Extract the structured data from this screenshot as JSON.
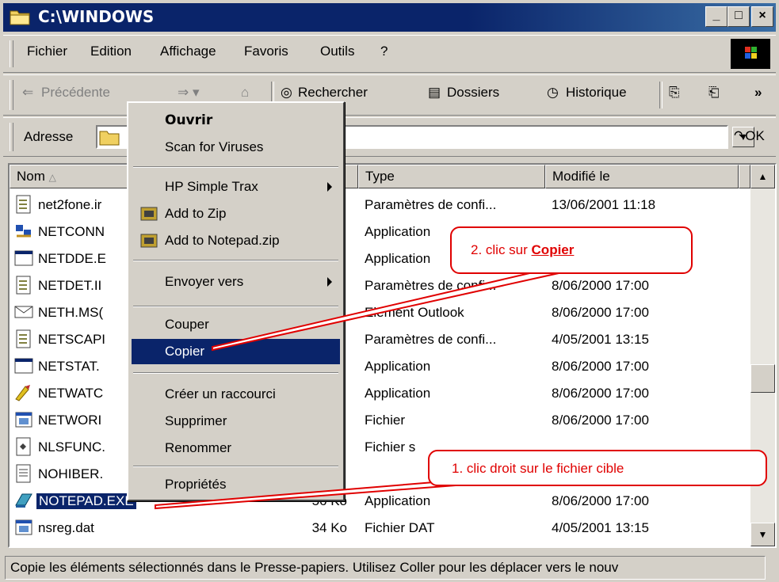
{
  "window": {
    "title": "C:\\WINDOWS",
    "min": "_",
    "max": "□",
    "close": "×"
  },
  "menubar": {
    "items": [
      "Fichier",
      "Edition",
      "Affichage",
      "Favoris",
      "Outils",
      "?"
    ]
  },
  "toolbar": {
    "back": "Précédente",
    "search": "Rechercher",
    "folders": "Dossiers",
    "history": "Historique",
    "more": "»"
  },
  "address": {
    "label": "Adresse",
    "go": "OK"
  },
  "columns": {
    "name": "Nom",
    "sort_indicator": "△",
    "type": "Type",
    "modified": "Modifié le"
  },
  "files": [
    {
      "name": "net2fone.ini",
      "size": "",
      "type": "Paramètres de confi...",
      "modified": "13/06/2001 11:18",
      "icon": "ini-file-icon"
    },
    {
      "name": "NETCONN.EXE",
      "size": "",
      "type": "Application",
      "modified": "",
      "icon": "network-exe-icon"
    },
    {
      "name": "NETDDE.EXE",
      "size": "",
      "type": "Application",
      "modified": "",
      "icon": "window-exe-icon"
    },
    {
      "name": "NETDET.INI",
      "size": "",
      "type": "Paramètres de confi...",
      "modified": "8/06/2000 17:00",
      "icon": "ini-file-icon"
    },
    {
      "name": "NETH.MSG",
      "size": "",
      "type": "Elément Outlook",
      "modified": "8/06/2000 17:00",
      "icon": "mail-icon"
    },
    {
      "name": "NETSCAPE.INI",
      "size": "",
      "type": "Paramètres de confi...",
      "modified": "4/05/2001 13:15",
      "icon": "ini-file-icon"
    },
    {
      "name": "NETSTAT.EXE",
      "size": "",
      "type": "Application",
      "modified": "8/06/2000 17:00",
      "icon": "window-exe-icon"
    },
    {
      "name": "NETWATCH.EXE",
      "size": "",
      "type": "Application",
      "modified": "8/06/2000 17:00",
      "icon": "netwatch-icon"
    },
    {
      "name": "NETWORK.TXT",
      "size": "",
      "type": "Fichier",
      "modified": "8/06/2000 17:00",
      "icon": "dat-file-icon"
    },
    {
      "name": "NLSFUNC.EXE",
      "size": "",
      "type": "Fichier s",
      "modified": "",
      "icon": "system-file-icon"
    },
    {
      "name": "NOHIBER.TXT",
      "size": "",
      "type": "",
      "modified": "",
      "icon": "text-file-icon"
    },
    {
      "name": "NOTEPAD.EXE",
      "size": "56 Ko",
      "type": "Application",
      "modified": "8/06/2000 17:00",
      "icon": "notepad-icon"
    },
    {
      "name": "nsreg.dat",
      "size": "34 Ko",
      "type": "Fichier DAT",
      "modified": "4/05/2001 13:15",
      "icon": "dat-file-icon"
    }
  ],
  "visible_names": [
    "net2fone.ir",
    "NETCONN",
    "NETDDE.E",
    "NETDET.II",
    "NETH.MS(",
    "NETSCAPI",
    "NETSTAT.",
    "NETWATC",
    "NETWORI",
    "NLSFUNC.",
    "NOHIBER.",
    "NOTEPAD.EXE",
    "nsreg.dat"
  ],
  "context_menu": {
    "open": "Ouvrir",
    "scan": "Scan for Viruses",
    "hp": "HP Simple Trax",
    "zip": "Add to Zip",
    "notepad_zip": "Add to Notepad.zip",
    "send_to": "Envoyer vers",
    "cut": "Couper",
    "copy": "Copier",
    "shortcut": "Créer un raccourci",
    "delete": "Supprimer",
    "rename": "Renommer",
    "properties": "Propriétés"
  },
  "callouts": {
    "step2_prefix": "2. clic sur ",
    "step2_bold": "Copier",
    "step1": "1. clic droit sur le fichier cible"
  },
  "status": {
    "text": "Copie les éléments sélectionnés dans le Presse-papiers. Utilisez Coller pour les déplacer vers le nouv"
  },
  "colors": {
    "titlebar": "#0a246a",
    "face": "#d4d0c8",
    "selection": "#0a246a",
    "callout": "#e00000"
  }
}
